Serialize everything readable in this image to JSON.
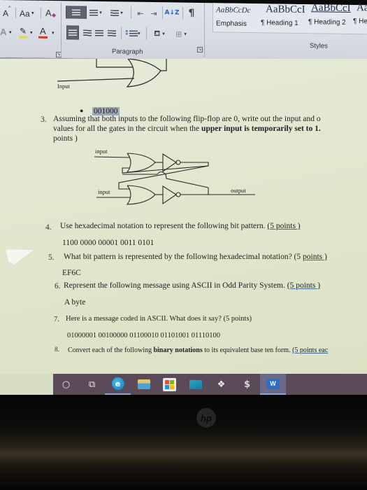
{
  "ribbon": {
    "font_group": {
      "grow_font_icon": "A",
      "change_case_label": "Aa",
      "clear_format_icon": "A",
      "text_effects_icon": "A",
      "highlight_color": "#e8d838",
      "font_color": "#d9362b",
      "font_color_icon": "A"
    },
    "paragraph_group": {
      "label": "Paragraph",
      "sort_icon": "A↓Z",
      "pilcrow": "¶"
    },
    "styles_group": {
      "label": "Styles",
      "samples": [
        {
          "sample": "AaBbCcDc",
          "name": "Emphasis"
        },
        {
          "sample": "AaBbCcI",
          "name": "¶ Heading 1"
        },
        {
          "sample": "AaBbCcI",
          "name": "¶ Heading 2"
        },
        {
          "sample": "AaB",
          "name": "¶ Hea"
        }
      ]
    }
  },
  "document": {
    "top_circuit": {
      "input_label": "Input"
    },
    "bullet_value": "001000",
    "questions": [
      {
        "number": "3.",
        "text_before": "Assuming that both inputs to the following flip-flop are 0, write out the input and o",
        "line2_before": "values for all the gates in the circuit when the ",
        "line2_bold": "upper input is temporarily set to 1.",
        "line3": "points )"
      },
      {
        "number": "4.",
        "text": "Use hexadecimal notation to represent the following bit pattern. ",
        "points": "(5 points )",
        "answer_data": "1100 0000 00001 0011 0101"
      },
      {
        "number": "5.",
        "text": "What bit pattern is represented by the following hexadecimal notation? (5 ",
        "points": "points )",
        "answer_data": "EF6C"
      },
      {
        "number": "6.",
        "text": "Represent the following message using ASCII in Odd Parity System. ",
        "points": "(5 points )",
        "answer_data": "A byte"
      },
      {
        "number": "7.",
        "text": "Here is a message coded in ASCII. What does it say? (5 points)",
        "answer_data": "01000001 00100000 01100010 01101001 01110100"
      },
      {
        "number": "8.",
        "text_before": "Convert each of the following ",
        "text_bold": "binary notations",
        "text_after": " to its equivalent base ten form. ",
        "points": "(5 points eac"
      }
    ],
    "flipflop": {
      "upper_input_label": "input",
      "lower_input_label": "input",
      "output_label": "output"
    }
  },
  "taskbar": {
    "items": [
      {
        "name": "search",
        "glyph": "○"
      },
      {
        "name": "task-view",
        "glyph": "⧉"
      },
      {
        "name": "edge",
        "glyph": "e"
      },
      {
        "name": "file-explorer",
        "glyph": "▬"
      },
      {
        "name": "store",
        "glyph": "▦"
      },
      {
        "name": "mail",
        "glyph": "✉"
      },
      {
        "name": "dropbox",
        "glyph": "❖"
      },
      {
        "name": "app-s",
        "glyph": "$"
      },
      {
        "name": "word",
        "glyph": "W"
      }
    ]
  },
  "bezel": {
    "logo": "hp"
  }
}
